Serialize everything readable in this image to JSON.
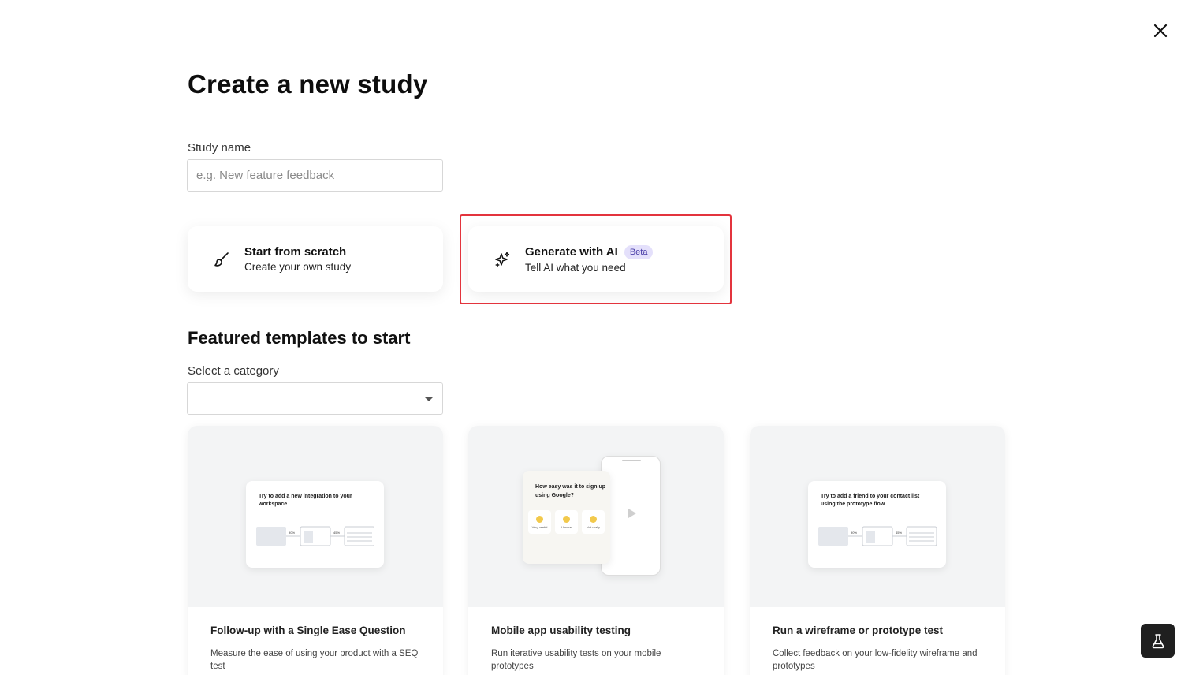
{
  "header": {
    "title": "Create a new study"
  },
  "study_name": {
    "label": "Study name",
    "placeholder": "e.g. New feature feedback"
  },
  "options": {
    "scratch": {
      "title": "Start from scratch",
      "subtitle": "Create your own study"
    },
    "ai": {
      "title": "Generate with AI",
      "badge": "Beta",
      "subtitle": "Tell AI what you need"
    }
  },
  "templates_section": {
    "title": "Featured templates to start",
    "category_label": "Select a category",
    "category_value": ""
  },
  "templates": [
    {
      "title": "Follow-up with a Single Ease Question",
      "description": "Measure the ease of using your product with a SEQ test",
      "preview_text": "Try to add a new integration to your workspace",
      "preview_stats": [
        "90%",
        "45%"
      ]
    },
    {
      "title": "Mobile app usability testing",
      "description": "Run iterative usability tests on your mobile prototypes",
      "preview_question": "How easy was it to sign up using Google?",
      "preview_options": [
        "Very useful",
        "Unsure",
        "Not really"
      ]
    },
    {
      "title": "Run a wireframe or prototype test",
      "description": "Collect feedback on your low-fidelity wireframe and prototypes",
      "preview_text": "Try to add a friend to your contact list using the prototype flow",
      "preview_stats": [
        "90%",
        "45%"
      ]
    }
  ],
  "colors": {
    "highlight": "#e3343d",
    "badge_bg": "#e4e0fb",
    "badge_text": "#4b3fa8",
    "fab_bg": "#1f1f1f"
  },
  "icons": {
    "close": "close-icon",
    "scratch": "brush-icon",
    "ai": "sparkle-icon",
    "dropdown": "caret-down-icon",
    "fab": "beaker-icon"
  }
}
